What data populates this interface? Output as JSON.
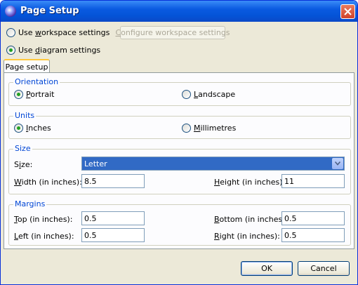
{
  "window": {
    "title": "Page Setup"
  },
  "scope": {
    "use_workspace": {
      "prefix": "Use ",
      "mnemonic": "w",
      "suffix": "orkspace settings",
      "checked": false
    },
    "configure_workspace": {
      "mnemonic": "C",
      "suffix": "onfigure workspace settings",
      "enabled": false
    },
    "use_diagram": {
      "prefix": "Use ",
      "mnemonic": "d",
      "suffix": "iagram settings",
      "checked": true
    }
  },
  "tabs": [
    {
      "label": "Page setup",
      "active": true
    }
  ],
  "orientation": {
    "legend": "Orientation",
    "portrait": {
      "mnemonic": "P",
      "suffix": "ortrait",
      "checked": true
    },
    "landscape": {
      "mnemonic": "L",
      "suffix": "andscape",
      "checked": false
    }
  },
  "units": {
    "legend": "Units",
    "inches": {
      "mnemonic": "I",
      "suffix": "nches",
      "checked": true
    },
    "millimetres": {
      "mnemonic": "M",
      "suffix": "illimetres",
      "checked": false
    }
  },
  "size": {
    "legend": "Size",
    "size_label": {
      "prefix": "S",
      "mnemonic": "i",
      "suffix": "ze:"
    },
    "size_value": "Letter",
    "width_label": {
      "mnemonic": "W",
      "suffix": "idth (in inches):"
    },
    "width_value": "8.5",
    "height_label": {
      "mnemonic": "H",
      "suffix": "eight (in inches):"
    },
    "height_value": "11"
  },
  "margins": {
    "legend": "Margins",
    "top_label": {
      "mnemonic": "T",
      "suffix": "op (in inches):"
    },
    "top_value": "0.5",
    "bottom_label": {
      "mnemonic": "B",
      "suffix": "ottom (in inches):"
    },
    "bottom_value": "0.5",
    "left_label": {
      "mnemonic": "L",
      "suffix": "eft (in inches):"
    },
    "left_value": "0.5",
    "right_label": {
      "mnemonic": "R",
      "suffix": "ight (in inches):"
    },
    "right_value": "0.5"
  },
  "buttons": {
    "ok": "OK",
    "cancel": "Cancel"
  },
  "colors": {
    "titlebar": "#0454d8",
    "accent": "#0046d5",
    "selection": "#316ac5",
    "dialog": "#ece9d8"
  }
}
